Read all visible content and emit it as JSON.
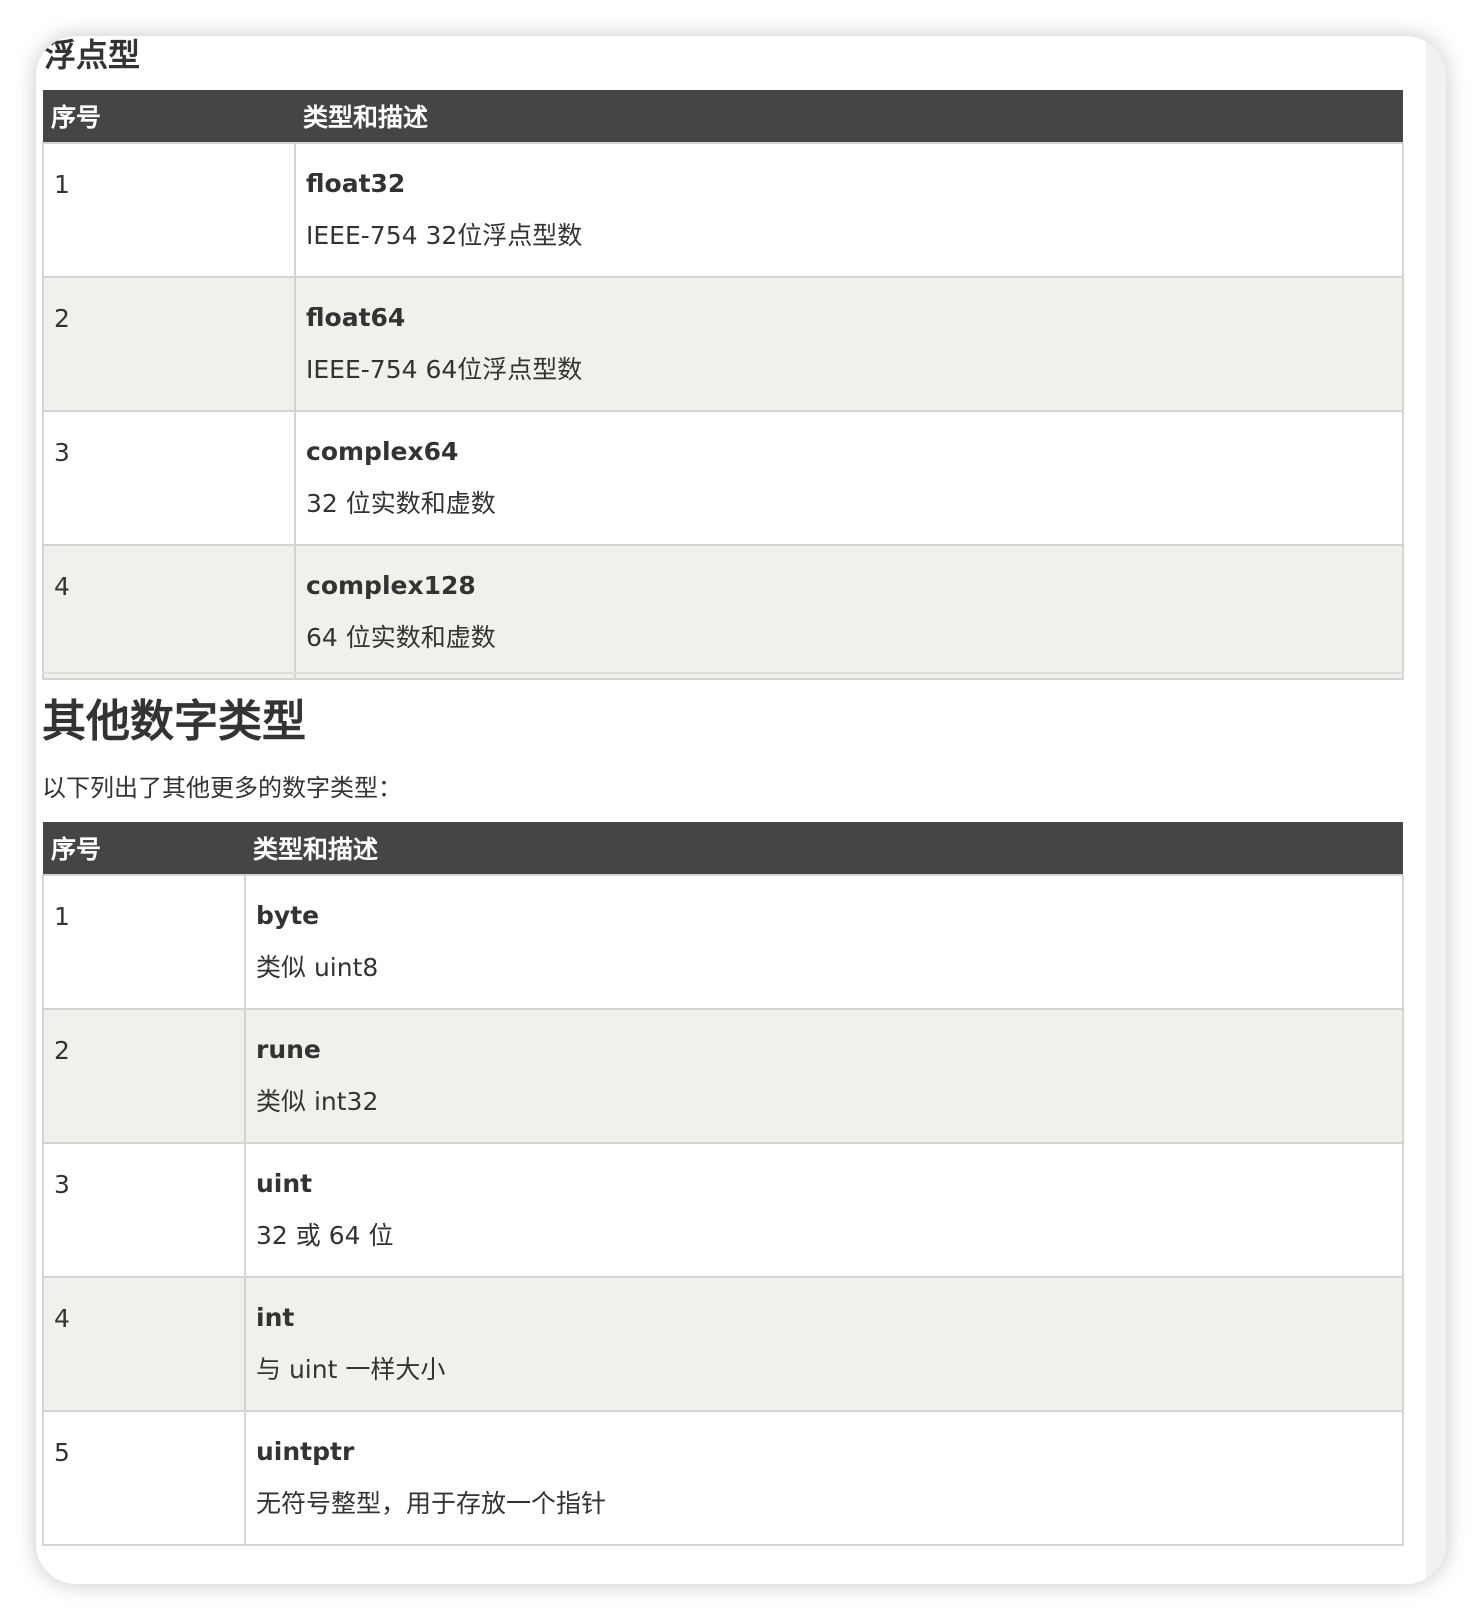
{
  "float_section": {
    "title": "浮点型",
    "headers": {
      "index": "序号",
      "type_desc": "类型和描述"
    },
    "rows": [
      {
        "index": "1",
        "type": "float32",
        "desc": "IEEE-754 32位浮点型数"
      },
      {
        "index": "2",
        "type": "float64",
        "desc": "IEEE-754 64位浮点型数"
      },
      {
        "index": "3",
        "type": "complex64",
        "desc": "32 位实数和虚数"
      },
      {
        "index": "4",
        "type": "complex128",
        "desc": "64 位实数和虚数"
      }
    ]
  },
  "other_section": {
    "title": "其他数字类型",
    "intro": "以下列出了其他更多的数字类型：",
    "headers": {
      "index": "序号",
      "type_desc": "类型和描述"
    },
    "rows": [
      {
        "index": "1",
        "type": "byte",
        "desc": "类似 uint8"
      },
      {
        "index": "2",
        "type": "rune",
        "desc": "类似 int32"
      },
      {
        "index": "3",
        "type": "uint",
        "desc": "32 或 64 位"
      },
      {
        "index": "4",
        "type": "int",
        "desc": "与 uint 一样大小"
      },
      {
        "index": "5",
        "type": "uintptr",
        "desc": "无符号整型，用于存放一个指针"
      }
    ]
  },
  "colors": {
    "header_bg": "#454545",
    "row_alt_bg": "#f2f0eb",
    "border": "#d4d4d4",
    "text": "#333333"
  }
}
